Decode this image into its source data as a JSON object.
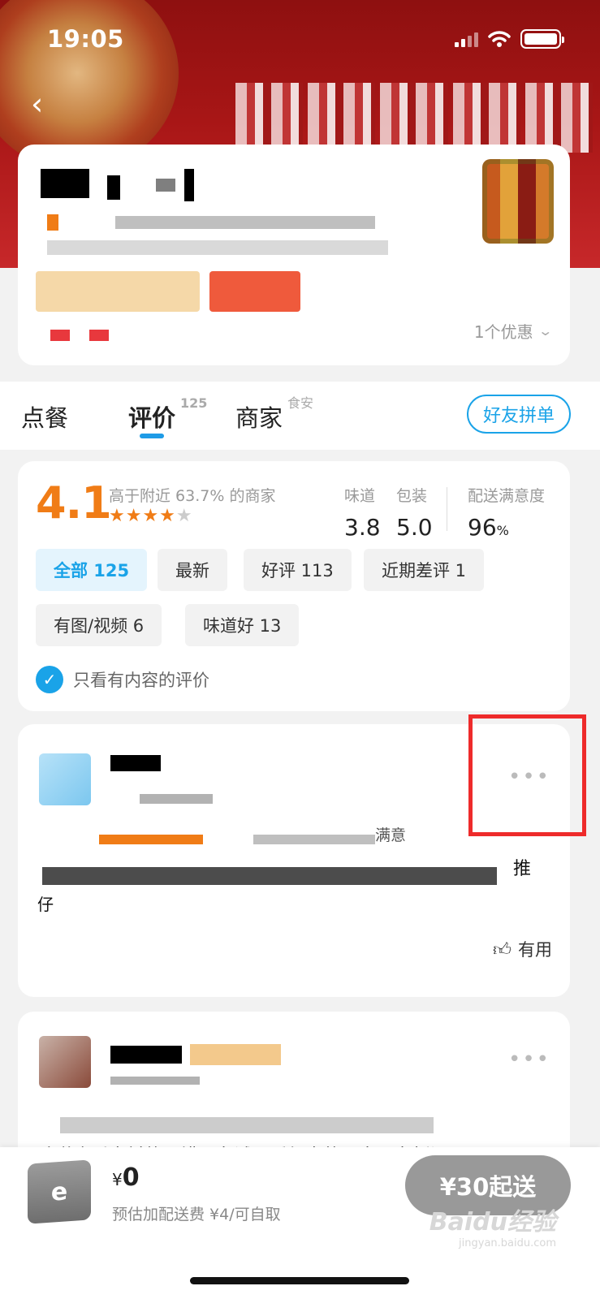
{
  "status_bar": {
    "time": "19:05"
  },
  "shop": {
    "discount_text": "1个优惠"
  },
  "tabs": [
    {
      "label": "点餐",
      "sup": ""
    },
    {
      "label": "评价",
      "sup": "125"
    },
    {
      "label": "商家",
      "sup": "食安"
    }
  ],
  "friend_button": "好友拼单",
  "rating": {
    "score": "4.1",
    "higher_text": "高于附近 63.7% 的商家",
    "stars_value": 4,
    "stars_max": 5,
    "taste_label": "味道",
    "taste_value": "3.8",
    "pack_label": "包装",
    "pack_value": "5.0",
    "delivery_label": "配送满意度",
    "delivery_value": "96",
    "delivery_unit": "%"
  },
  "filters": [
    {
      "label": "全部 125",
      "active": true
    },
    {
      "label": "最新",
      "active": false
    },
    {
      "label": "好评 113",
      "active": false
    },
    {
      "label": "近期差评 1",
      "active": false
    },
    {
      "label": "有图/视频 6",
      "active": false
    },
    {
      "label": "味道好 13",
      "active": false
    }
  ],
  "only_content_label": "只看有内容的评价",
  "reviews": [
    {
      "fragment_1": "满意",
      "fragment_2": "推",
      "fragment_3": "仔",
      "helpful": "有用"
    },
    {
      "fragment_1": "味道也乐意料的不错，老试了睡便点的一家，老板还"
    }
  ],
  "bottom_bar": {
    "currency": "¥",
    "price": "0",
    "fee_text": "预估加配送费 ¥4/可自取",
    "min_order": "¥30起送"
  },
  "watermark": {
    "main": "Baidu经验",
    "sub": "jingyan.baidu.com"
  },
  "colors": {
    "accent": "#1aa3e8",
    "score": "#f07c16",
    "highlight": "#ee2b2b"
  }
}
